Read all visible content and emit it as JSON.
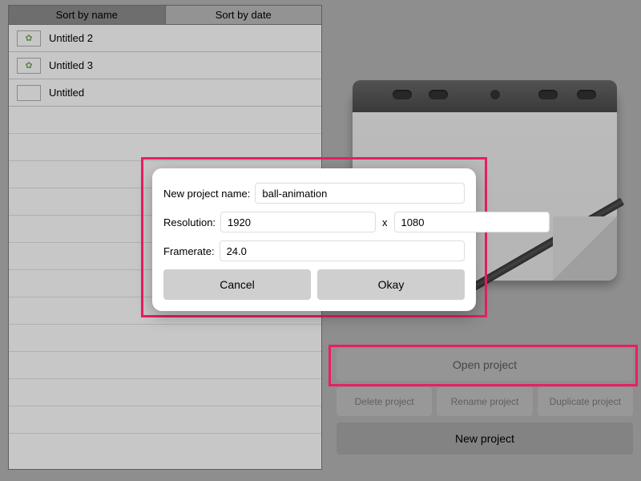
{
  "sort_tabs": {
    "by_name": "Sort by name",
    "by_date": "Sort by date",
    "active": "name"
  },
  "projects": [
    {
      "label": "Untitled 2",
      "thumb_glyph": "✿"
    },
    {
      "label": "Untitled 3",
      "thumb_glyph": "✿"
    },
    {
      "label": "Untitled",
      "thumb_glyph": ""
    }
  ],
  "actions": {
    "open": "Open project",
    "delete": "Delete project",
    "rename": "Rename project",
    "duplicate": "Duplicate project",
    "new": "New project"
  },
  "dialog": {
    "name_label": "New project name:",
    "name_value": "ball-animation",
    "resolution_label": "Resolution:",
    "resolution_w": "1920",
    "resolution_sep": "x",
    "resolution_h": "1080",
    "framerate_label": "Framerate:",
    "framerate_value": "24.0",
    "cancel": "Cancel",
    "okay": "Okay"
  }
}
